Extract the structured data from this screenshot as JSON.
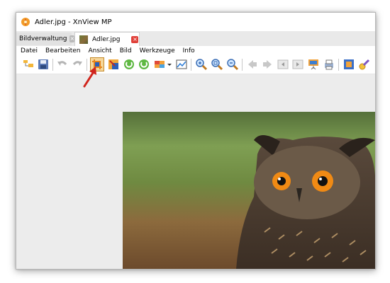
{
  "window": {
    "title": "Adler.jpg - XnView MP"
  },
  "tabs": [
    {
      "label": "Bildverwaltung",
      "active": false
    },
    {
      "label": "Adler.jpg",
      "active": true
    }
  ],
  "menu": [
    "Datei",
    "Bearbeiten",
    "Ansicht",
    "Bild",
    "Werkzeuge",
    "Info"
  ],
  "toolbar": {
    "buttons": [
      "browser-icon",
      "save-icon",
      "undo-icon",
      "redo-icon",
      "crop-icon",
      "resize-icon",
      "rotate-left-icon",
      "rotate-right-icon",
      "color-adjust-icon",
      "histogram-icon",
      "zoom-in-icon",
      "zoom-fit-icon",
      "zoom-out-icon",
      "previous-icon",
      "next-icon",
      "first-icon",
      "last-icon",
      "slideshow-icon",
      "print-icon",
      "fullscreen-icon",
      "settings-icon"
    ],
    "highlighted": "crop-icon"
  },
  "colors": {
    "accent_red": "#d0241c",
    "tab_close_red": "#e0413a"
  }
}
